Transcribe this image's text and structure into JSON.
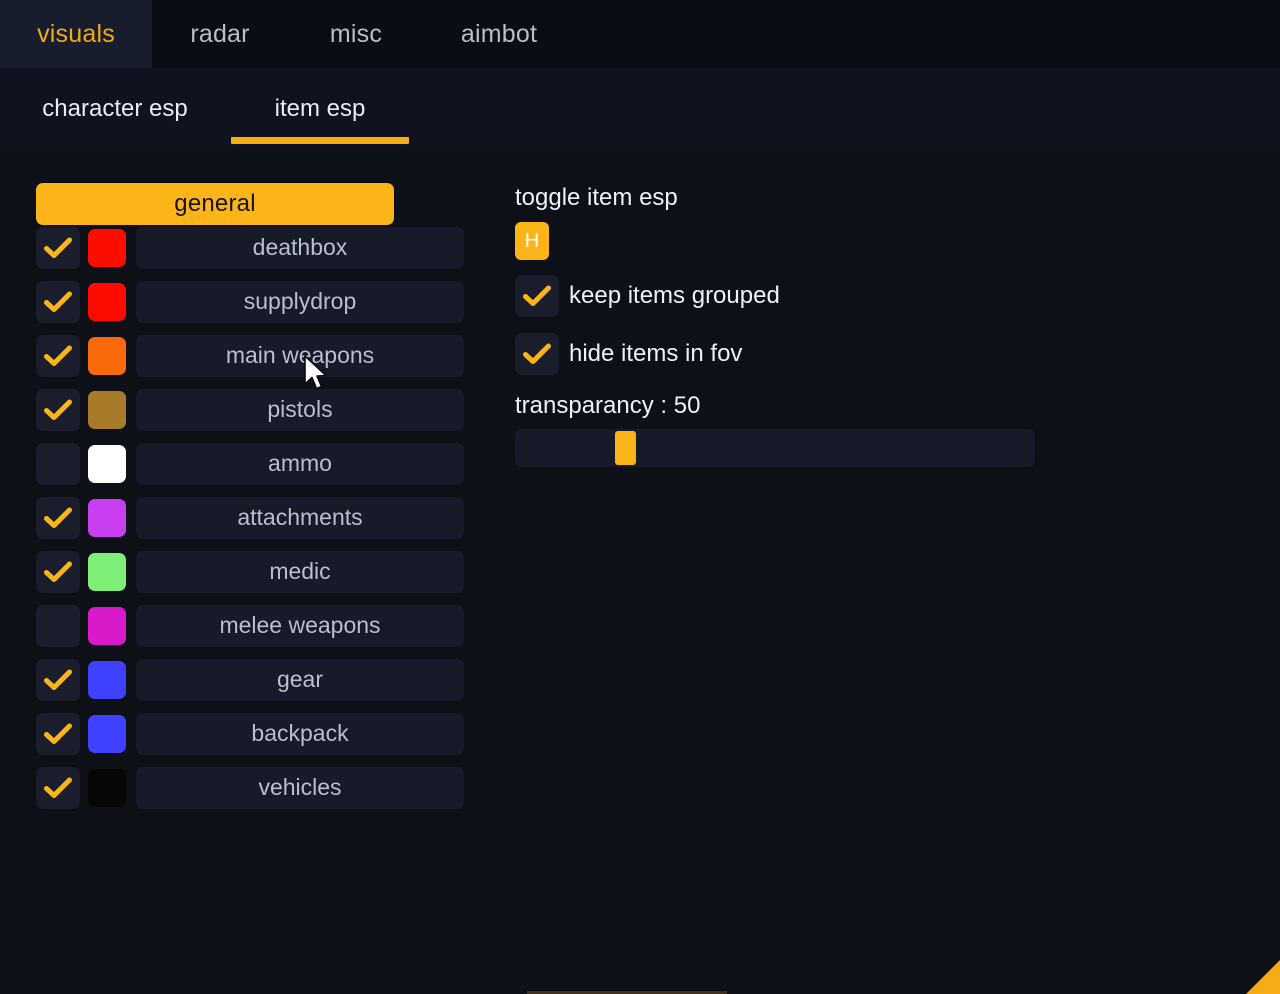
{
  "window": {
    "title": "visuals",
    "accent_color": "#fbb519",
    "background_color": "#0b0d16",
    "panel_color": "#171b29"
  },
  "top_tabs": [
    {
      "label": "visuals",
      "active": true
    },
    {
      "label": "radar",
      "active": false
    },
    {
      "label": "misc",
      "active": false
    },
    {
      "label": "aimbot",
      "active": false
    }
  ],
  "sub_tabs": [
    {
      "label": "character esp",
      "active": false
    },
    {
      "label": "item esp",
      "active": true
    }
  ],
  "left_panel": {
    "group_button": "general",
    "items": [
      {
        "label": "deathbox",
        "checked": true,
        "color": "#fc0d00"
      },
      {
        "label": "supplydrop",
        "checked": true,
        "color": "#fd0b00"
      },
      {
        "label": "main weapons",
        "checked": true,
        "color": "#f96a0b"
      },
      {
        "label": "pistols",
        "checked": true,
        "color": "#a87b2b"
      },
      {
        "label": "ammo",
        "checked": false,
        "color": "#ffffff"
      },
      {
        "label": "attachments",
        "checked": true,
        "color": "#c93ff0"
      },
      {
        "label": "medic",
        "checked": true,
        "color": "#7fee77"
      },
      {
        "label": "melee weapons",
        "checked": false,
        "color": "#d81acb"
      },
      {
        "label": "gear",
        "checked": true,
        "color": "#4040ff"
      },
      {
        "label": "backpack",
        "checked": true,
        "color": "#4040ff"
      },
      {
        "label": "vehicles",
        "checked": true,
        "color": "#060606"
      }
    ]
  },
  "right_panel": {
    "toggle_title": "toggle item esp",
    "keybind": "H",
    "options": [
      {
        "label": "keep items grouped",
        "checked": true
      },
      {
        "label": "hide items in fov",
        "checked": true
      }
    ],
    "slider": {
      "label": "transparancy : 50",
      "value": 50,
      "min": 0,
      "max": 255,
      "fill_percent": 20
    }
  }
}
